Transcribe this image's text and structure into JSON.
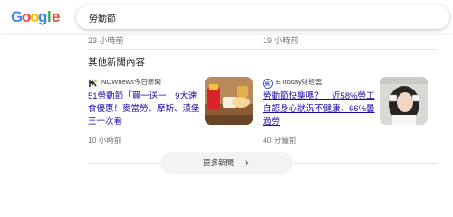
{
  "header": {
    "logo_letters": [
      "G",
      "o",
      "o",
      "g",
      "l",
      "e"
    ],
    "search_query": "勞動節"
  },
  "top_times": [
    "23 小時前",
    "19 小時前"
  ],
  "section": {
    "title": "其他新聞內容"
  },
  "articles": [
    {
      "source": "NOWnews今日新聞",
      "headline": "51勞動節「買一送一」9大速食優惠！麥當勞、摩斯、漢堡王一次看",
      "time": "10 小時前"
    },
    {
      "source": "ETtoday財經雲",
      "headline": "勞動節快樂嗎？　近58%勞工自認身心狀況不健康，66%曇過勞",
      "time": "40 分鐘前"
    }
  ],
  "more_button": {
    "label": "更多新聞",
    "icon": "chevron-right-icon"
  },
  "colors": {
    "link": "#1a0dab",
    "meta": "#70757a",
    "button_bg": "#f1f3f4"
  }
}
